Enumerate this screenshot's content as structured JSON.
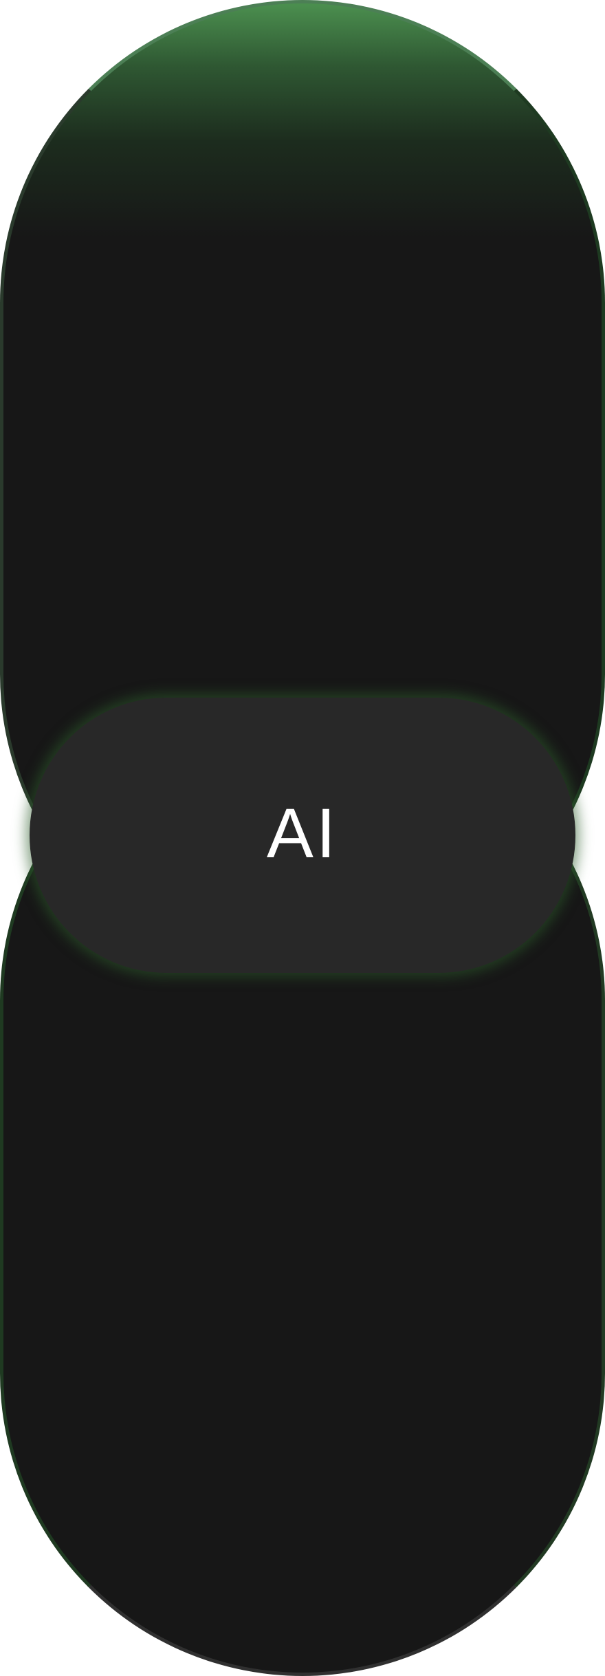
{
  "assistant": {
    "label": "AI"
  },
  "theme": {
    "background": "#171717",
    "accent": "#4e9652",
    "orb_fill": "#282828",
    "text": "#ffffff"
  }
}
